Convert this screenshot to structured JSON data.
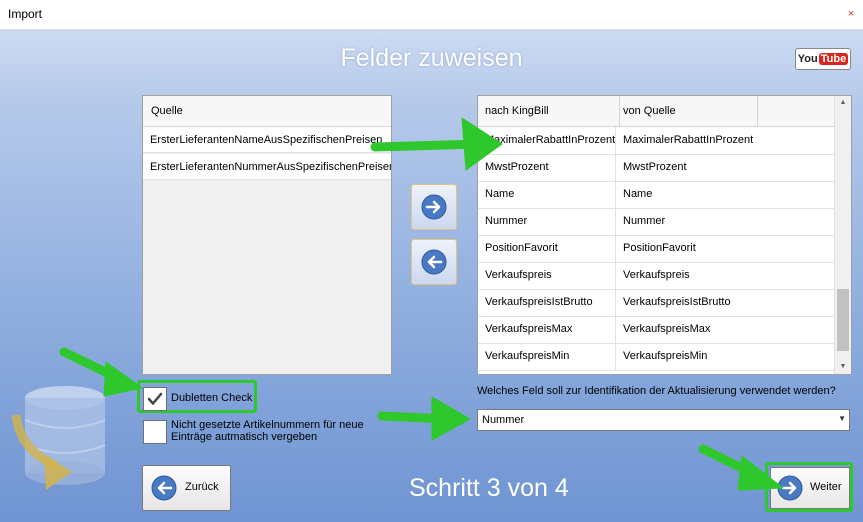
{
  "window": {
    "title": "Import",
    "close_label": "×"
  },
  "header": {
    "title": "Felder zuweisen",
    "youtube_you": "You",
    "youtube_tube": "Tube"
  },
  "source_list": {
    "header": "Quelle",
    "items": [
      "ErsterLieferantenNameAusSpezifischenPreisen",
      "ErsterLieferantenNummerAusSpezifischenPreisen"
    ]
  },
  "mapping_grid": {
    "headers": [
      "nach KingBill",
      "von Quelle"
    ],
    "rows": [
      [
        "MaximalerRabattInProzent",
        "MaximalerRabattInProzent"
      ],
      [
        "MwstProzent",
        "MwstProzent"
      ],
      [
        "Name",
        "Name"
      ],
      [
        "Nummer",
        "Nummer"
      ],
      [
        "PositionFavorit",
        "PositionFavorit"
      ],
      [
        "Verkaufspreis",
        "Verkaufspreis"
      ],
      [
        "VerkaufspreisIstBrutto",
        "VerkaufspreisIstBrutto"
      ],
      [
        "VerkaufspreisMax",
        "VerkaufspreisMax"
      ],
      [
        "VerkaufspreisMin",
        "VerkaufspreisMin"
      ]
    ]
  },
  "options": {
    "dubletten_label": "Dubletten Check",
    "dubletten_checked": true,
    "artikel_label": "Nicht gesetzte Artikelnummern für neue Einträge autmatisch vergeben",
    "artikel_checked": false
  },
  "identification": {
    "question": "Welches Feld soll zur Identifikation der Aktualisierung verwendet werden?",
    "selected": "Nummer"
  },
  "footer": {
    "back_label": "Zurück",
    "step_text": "Schritt 3 von 4",
    "next_label": "Weiter"
  },
  "colors": {
    "highlight_green": "#2ec82c",
    "arrow_blue": "#4a79c4"
  }
}
